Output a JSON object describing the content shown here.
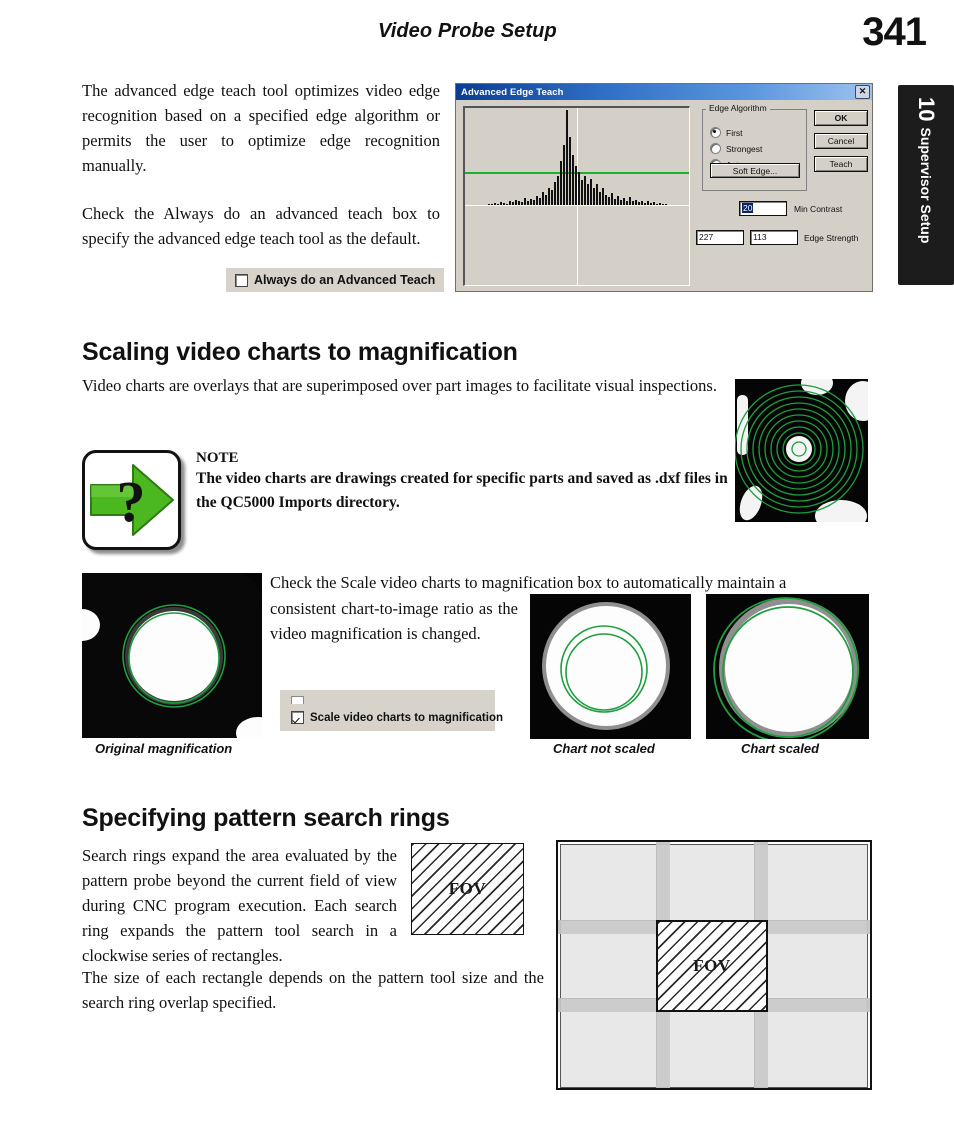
{
  "header": {
    "running_title": "Video Probe Setup",
    "page_number": "341"
  },
  "chapter_tab": {
    "number": "10",
    "title": "Supervisor Setup"
  },
  "intro": {
    "paragraph_1": "The advanced edge teach tool optimizes video edge recognition based on a specified edge algorithm or permits the user to optimize edge recognition manually.",
    "paragraph_2": "Check the Always do an advanced teach box to specify the advanced edge teach tool as the default."
  },
  "always_teach_checkbox": {
    "label": "Always do an Advanced Teach",
    "checked": false
  },
  "dialog": {
    "title": "Advanced Edge Teach",
    "close_label": "✕",
    "group_label": "Edge Algorithm",
    "radios": [
      {
        "label": "First",
        "selected": true
      },
      {
        "label": "Strongest",
        "selected": false
      },
      {
        "label": "Auto",
        "selected": false
      }
    ],
    "soft_edge_button": "Soft Edge...",
    "ok_button": "OK",
    "cancel_button": "Cancel",
    "teach_button": "Teach",
    "min_contrast_value": "20",
    "min_contrast_label": "Min Contrast",
    "edge_strength_value_1": "227",
    "edge_strength_value_2": "113",
    "edge_strength_label": "Edge Strength"
  },
  "section_scaling": {
    "heading": "Scaling video charts to magnification",
    "paragraph": "Video charts are overlays that are superimposed over part images to facilitate visual inspections.",
    "note_heading": "NOTE",
    "note_body": "The video charts are drawings created for specific parts and saved as .dxf files in the QC5000 Imports directory.",
    "scale_paragraph_lead": "Check the Scale video charts to magnification box to automatically maintain a",
    "scale_paragraph_rest": "consistent chart-to-image ratio as the video magnification is changed."
  },
  "scale_charts_checkbox": {
    "label": "Scale video charts to magnification",
    "checked": true
  },
  "figure_captions": {
    "original": "Original magnification",
    "not_scaled": "Chart not scaled",
    "scaled": "Chart scaled"
  },
  "section_rings": {
    "heading": "Specifying pattern search rings",
    "paragraph_1": "Search rings expand the area evaluated by the pattern probe beyond the current field of view during CNC program execution. Each search ring expands the pattern tool search in a clockwise series of rectangles.",
    "paragraph_2": "The size of each rectangle depends on the pattern tool size and the search ring overlap specified."
  },
  "fov": {
    "label": "FOV",
    "diagram_label": "FOV"
  },
  "colors": {
    "chart_green": "#1e9e3e",
    "note_arrow_green": "#4cb820",
    "dialog_face": "#d4d0c8",
    "title_bar_blue": "#0a3d91",
    "selection_blue": "#0a246a"
  }
}
